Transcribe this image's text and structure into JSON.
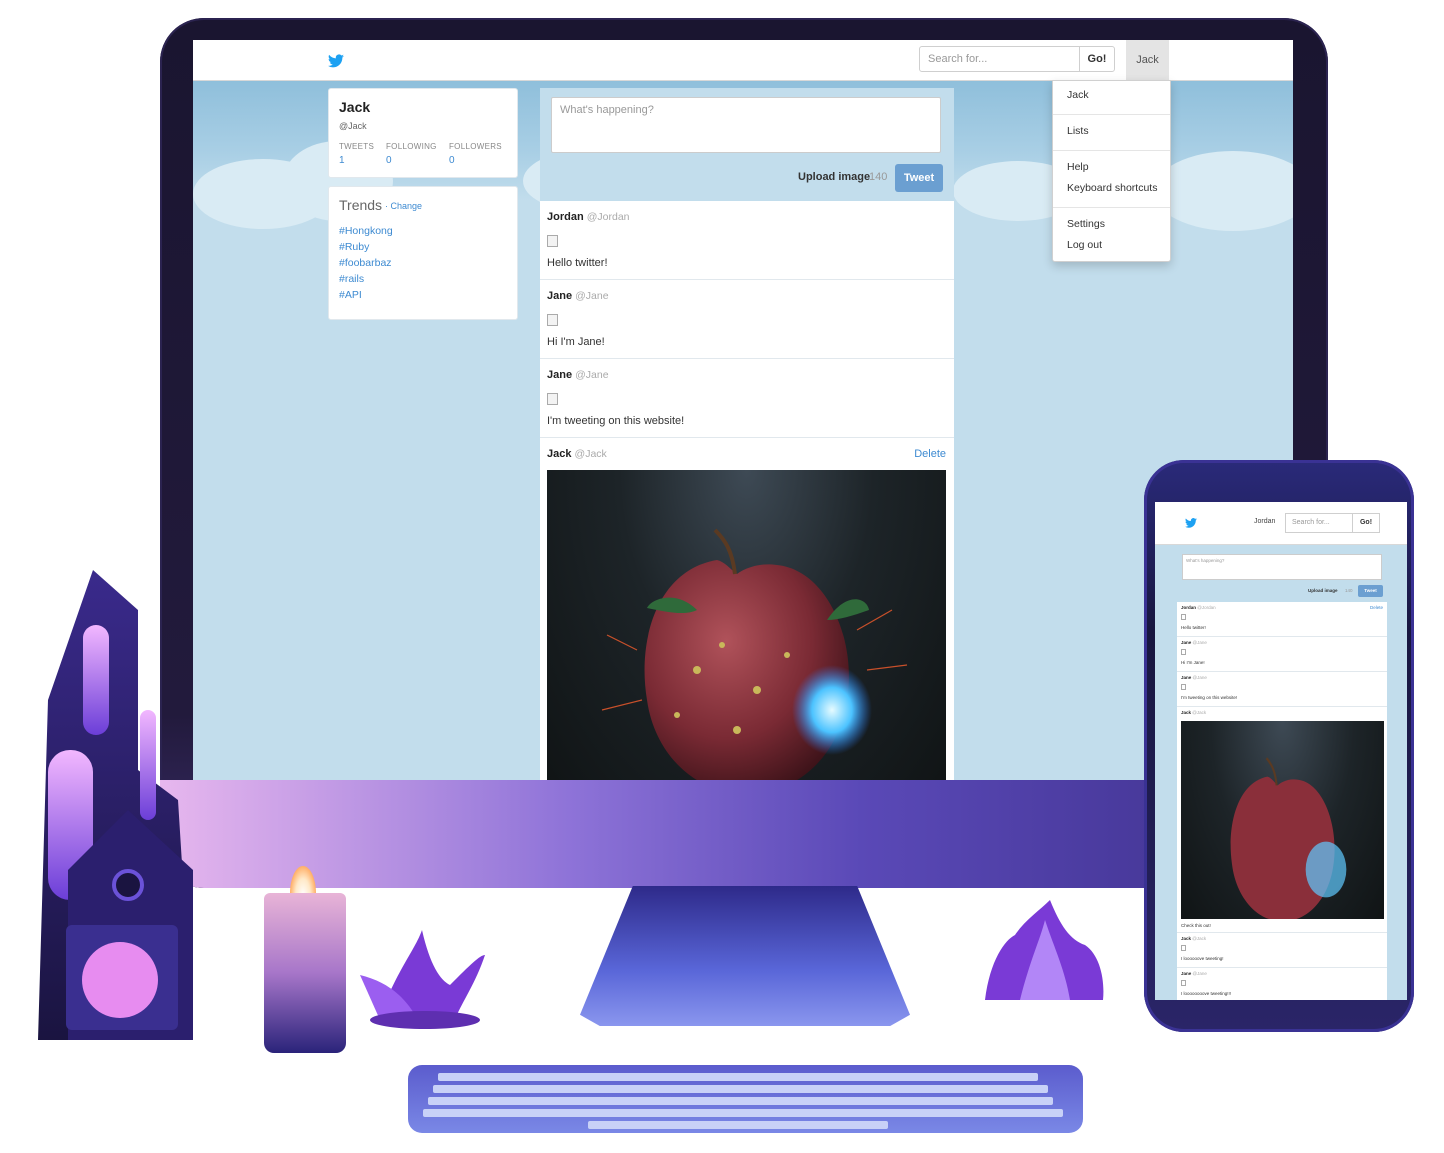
{
  "desktop": {
    "navbar": {
      "search_placeholder": "Search for...",
      "go_label": "Go!",
      "user_label": "Jack"
    },
    "dropdown": {
      "items": [
        "Jack",
        "Lists",
        "Help",
        "Keyboard shortcuts",
        "Settings",
        "Log out"
      ]
    },
    "profile": {
      "name": "Jack",
      "handle": "@Jack",
      "stats": [
        {
          "label": "TWEETS",
          "value": "1"
        },
        {
          "label": "FOLLOWING",
          "value": "0"
        },
        {
          "label": "FOLLOWERS",
          "value": "0"
        }
      ]
    },
    "trends": {
      "title": "Trends",
      "change_label": "· Change",
      "items": [
        "#Hongkong",
        "#Ruby",
        "#foobarbaz",
        "#rails",
        "#API"
      ]
    },
    "compose": {
      "placeholder": "What's happening?",
      "upload_label": "Upload image",
      "counter": "140",
      "tweet_label": "Tweet"
    },
    "tweets": [
      {
        "author": "Jordan",
        "handle": "@Jordan",
        "text": "Hello twitter!"
      },
      {
        "author": "Jane",
        "handle": "@Jane",
        "text": "Hi I'm Jane!"
      },
      {
        "author": "Jane",
        "handle": "@Jane",
        "text": "I'm tweeting on this website!"
      },
      {
        "author": "Jack",
        "handle": "@Jack",
        "delete_label": "Delete"
      }
    ]
  },
  "phone": {
    "navbar": {
      "user_label": "Jordan",
      "search_placeholder": "Search for...",
      "go_label": "Go!"
    },
    "compose": {
      "placeholder": "What's happening?",
      "upload_label": "Upload image",
      "counter": "140",
      "tweet_label": "Tweet"
    },
    "tweets": [
      {
        "author": "Jordan",
        "handle": "@Jordan",
        "text": "Hello twitter!",
        "delete_label": "Delete"
      },
      {
        "author": "Jane",
        "handle": "@Jane",
        "text": "Hi I'm Jane!"
      },
      {
        "author": "Jane",
        "handle": "@Jane",
        "text": "I'm tweeting on this website!"
      },
      {
        "author": "Jack",
        "handle": "@Jack",
        "text": "Check this out!"
      },
      {
        "author": "Jack",
        "handle": "@Jack",
        "text": "I loooooove tweeting!"
      },
      {
        "author": "Jane",
        "handle": "@Jane",
        "text": "I loooooooove tweeting!!!"
      }
    ]
  },
  "colors": {
    "link": "#3d8ad1",
    "tweet_button": "#6b9fd1",
    "page_background": "#c2ddec",
    "brand_bird": "#1da1f2"
  },
  "icons": [
    "twitter-bird-icon"
  ]
}
